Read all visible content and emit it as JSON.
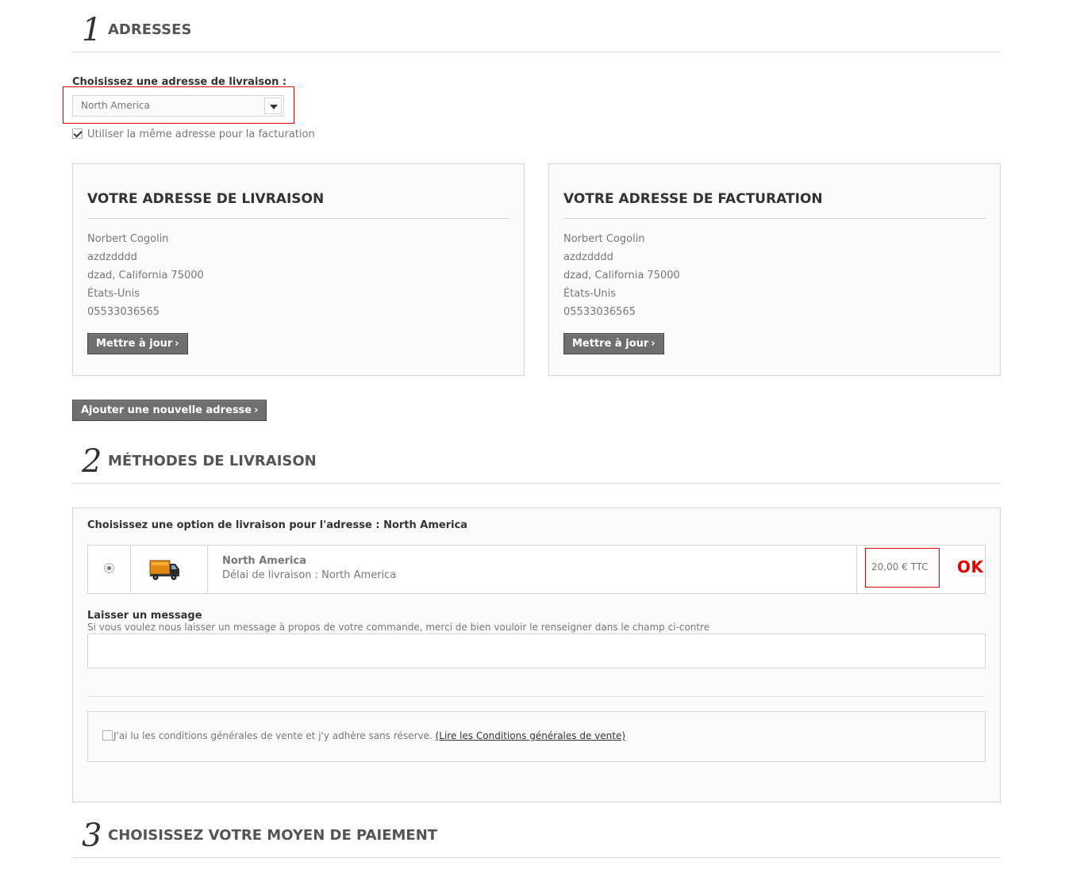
{
  "step1": {
    "number": "1",
    "title": "ADRESSES"
  },
  "address_select": {
    "label": "Choisissez une adresse de livraison :",
    "selected": "North America"
  },
  "same_billing": {
    "label": "Utiliser la même adresse pour la facturation",
    "checked": true
  },
  "delivery_address": {
    "title": "VOTRE ADRESSE DE LIVRAISON",
    "lines": [
      "Norbert Cogolin",
      "azdzdddd",
      "dzad, California 75000",
      "États-Unis",
      "05533036565"
    ],
    "update_label": "Mettre à jour"
  },
  "billing_address": {
    "title": "VOTRE ADRESSE DE FACTURATION",
    "lines": [
      "Norbert Cogolin",
      "azdzdddd",
      "dzad, California 75000",
      "États-Unis",
      "05533036565"
    ],
    "update_label": "Mettre à jour"
  },
  "add_address_label": "Ajouter une nouvelle adresse",
  "step2": {
    "number": "2",
    "title": "MÉTHODES DE LIVRAISON"
  },
  "shipping": {
    "title": "Choisissez une option de livraison pour l'adresse : North America",
    "carrier_name": "North America",
    "carrier_delay": "Délai de livraison : North America",
    "price": "20,00 € TTC",
    "ok_mark": "OK",
    "carrier_icon": "truck-icon",
    "selected": true
  },
  "message": {
    "title": "Laisser un message",
    "help": "Si vous voulez nous laisser un message à propos de votre commande, merci de bien vouloir le renseigner dans le champ ci-contre",
    "value": ""
  },
  "cgv": {
    "text": "J'ai lu les conditions générales de vente et j'y adhère sans réserve.",
    "link": "(Lire les Conditions générales de vente)",
    "checked": false
  },
  "step3": {
    "number": "3",
    "title": "CHOISISSEZ VOTRE MOYEN DE PAIEMENT"
  },
  "colors": {
    "accent_red": "#e30000",
    "button_gray": "#6f6f6f",
    "border": "#d6d4d4"
  }
}
